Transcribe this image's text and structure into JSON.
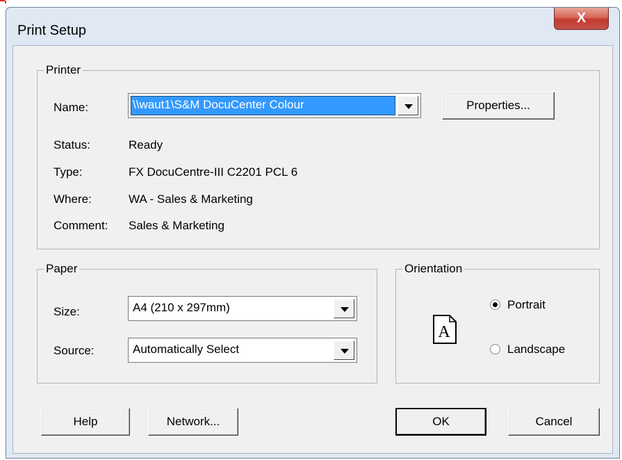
{
  "window": {
    "title": "Print Setup",
    "close_label": "X"
  },
  "printer": {
    "group_label": "Printer",
    "name_label": "Name:",
    "name_value": "\\\\waut1\\S&M DocuCenter Colour",
    "properties_label": "Properties...",
    "status_label": "Status:",
    "status_value": "Ready",
    "type_label": "Type:",
    "type_value": "FX DocuCentre-III C2201 PCL 6",
    "where_label": "Where:",
    "where_value": "WA - Sales & Marketing",
    "comment_label": "Comment:",
    "comment_value": "Sales & Marketing"
  },
  "paper": {
    "group_label": "Paper",
    "size_label": "Size:",
    "size_value": "A4 (210 x 297mm)",
    "source_label": "Source:",
    "source_value": "Automatically Select"
  },
  "orientation": {
    "group_label": "Orientation",
    "page_letter": "A",
    "portrait_label": "Portrait",
    "landscape_label": "Landscape",
    "selected": "Portrait"
  },
  "buttons": {
    "help": "Help",
    "network": "Network...",
    "ok": "OK",
    "cancel": "Cancel"
  }
}
